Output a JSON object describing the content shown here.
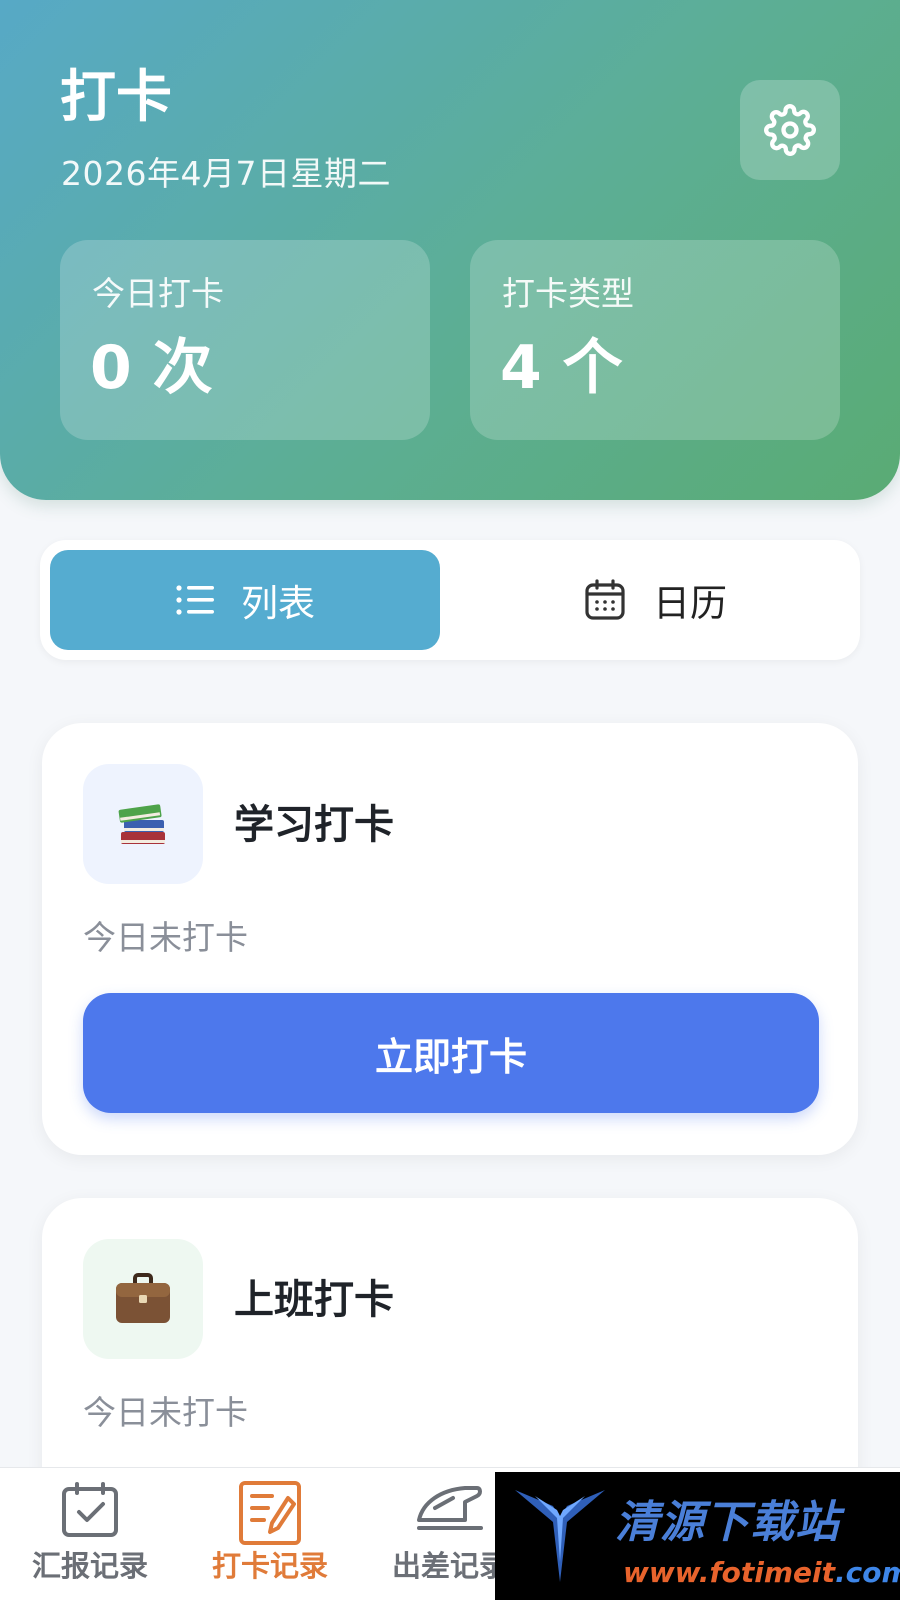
{
  "header": {
    "title": "打卡",
    "date": "2026年4月7日星期二",
    "settings_icon": "gear-icon",
    "stats": [
      {
        "label": "今日打卡",
        "value": "0 次"
      },
      {
        "label": "打卡类型",
        "value": "4 个"
      }
    ]
  },
  "view_toggle": {
    "list_label": "列表",
    "calendar_label": "日历",
    "active": "list"
  },
  "cards": [
    {
      "title": "学习打卡",
      "icon": "books-icon",
      "status": "今日未打卡",
      "button_label": "立即打卡"
    },
    {
      "title": "上班打卡",
      "icon": "briefcase-icon",
      "status": "今日未打卡"
    }
  ],
  "tabbar": {
    "items": [
      {
        "label": "汇报记录",
        "icon": "calendar-check-icon",
        "active": false
      },
      {
        "label": "打卡记录",
        "icon": "edit-list-icon",
        "active": true
      },
      {
        "label": "出差记录",
        "icon": "train-icon",
        "active": false
      }
    ]
  },
  "watermark": {
    "text": "清源下载站",
    "url_prefix": "www.",
    "url_brand": "fotimeit",
    "url_suffix": ".com"
  },
  "colors": {
    "header_gradient_start": "#57a9c6",
    "header_gradient_end": "#5aab74",
    "toggle_active": "#55acd0",
    "primary_button": "#4d78ec",
    "tab_active": "#e07b39"
  }
}
